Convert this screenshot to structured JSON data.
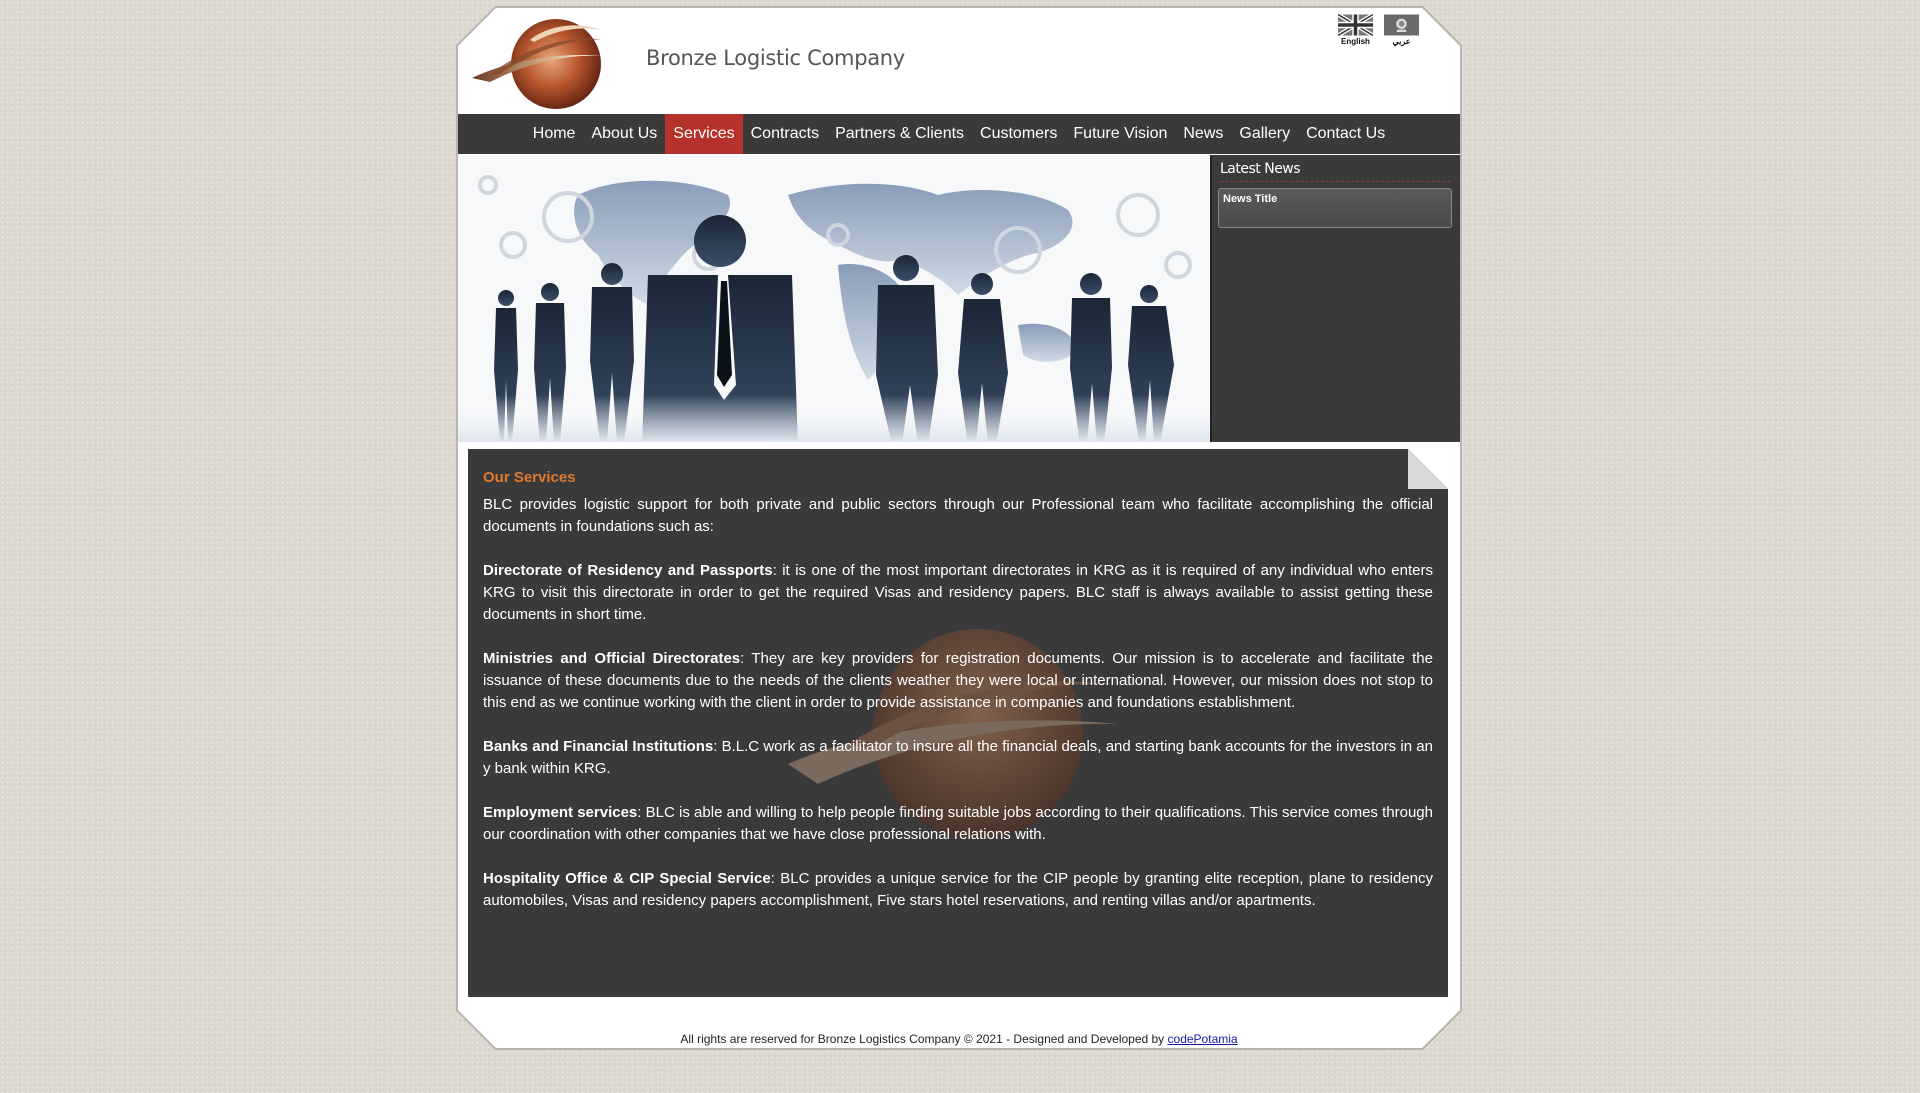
{
  "header": {
    "company_name": "Bronze Logistic Company",
    "languages": [
      {
        "label": "English",
        "icon": "uk-flag-icon"
      },
      {
        "label": "عربي",
        "icon": "kurdistan-emblem-icon"
      }
    ]
  },
  "nav": {
    "items": [
      {
        "label": "Home"
      },
      {
        "label": "About Us"
      },
      {
        "label": "Services"
      },
      {
        "label": "Contracts"
      },
      {
        "label": "Partners & Clients"
      },
      {
        "label": "Customers"
      },
      {
        "label": "Future Vision"
      },
      {
        "label": "News"
      },
      {
        "label": "Gallery"
      },
      {
        "label": "Contact Us"
      }
    ],
    "active": "Services"
  },
  "news": {
    "heading": "Latest News",
    "items": [
      {
        "title": "News Title"
      }
    ]
  },
  "content": {
    "title": "Our Services",
    "intro": "BLC provides logistic support for both private and public sectors through our Professional team who facilitate accomplishing the official documents in foundations such as:",
    "sections": [
      {
        "heading": "Directorate of Residency and Passports",
        "text": ": it is one of the most important directorates in KRG as it is required of any individual who enters KRG to visit this directorate in order to get the required Visas and residency papers. BLC staff is always available to assist getting these documents in short time."
      },
      {
        "heading": "Ministries and Official Directorates",
        "text": ": They are key providers for registration documents. Our mission is to accelerate and facilitate the issuance of these documents due to the needs of the clients weather they were local or international. However, our mission does not stop to this end as we continue working with the client in order to provide assistance in companies and foundations establishment."
      },
      {
        "heading": "Banks and Financial Institutions",
        "text": ": B.L.C work as a facilitator to insure all the financial deals, and starting bank accounts for the investors in an y bank within KRG."
      },
      {
        "heading": "Employment services",
        "text": ": BLC is able and willing to help people finding suitable jobs according to their qualifications. This service comes through our coordination with other companies that we have close professional relations with."
      },
      {
        "heading": "Hospitality Office & CIP Special Service",
        "text": ": BLC provides a unique service for the CIP people by granting elite reception, plane to residency automobiles, Visas and residency papers accomplishment, Five stars hotel reservations, and renting villas and/or apartments."
      }
    ]
  },
  "footer": {
    "text": "All rights are reserved for Bronze Logistics Company © 2021 - Designed and Developed by",
    "link": "codePotamia"
  },
  "colors": {
    "accent_red": "#b5322b",
    "title_orange": "#e07a2c",
    "panel_dark": "#3a3a3a"
  }
}
